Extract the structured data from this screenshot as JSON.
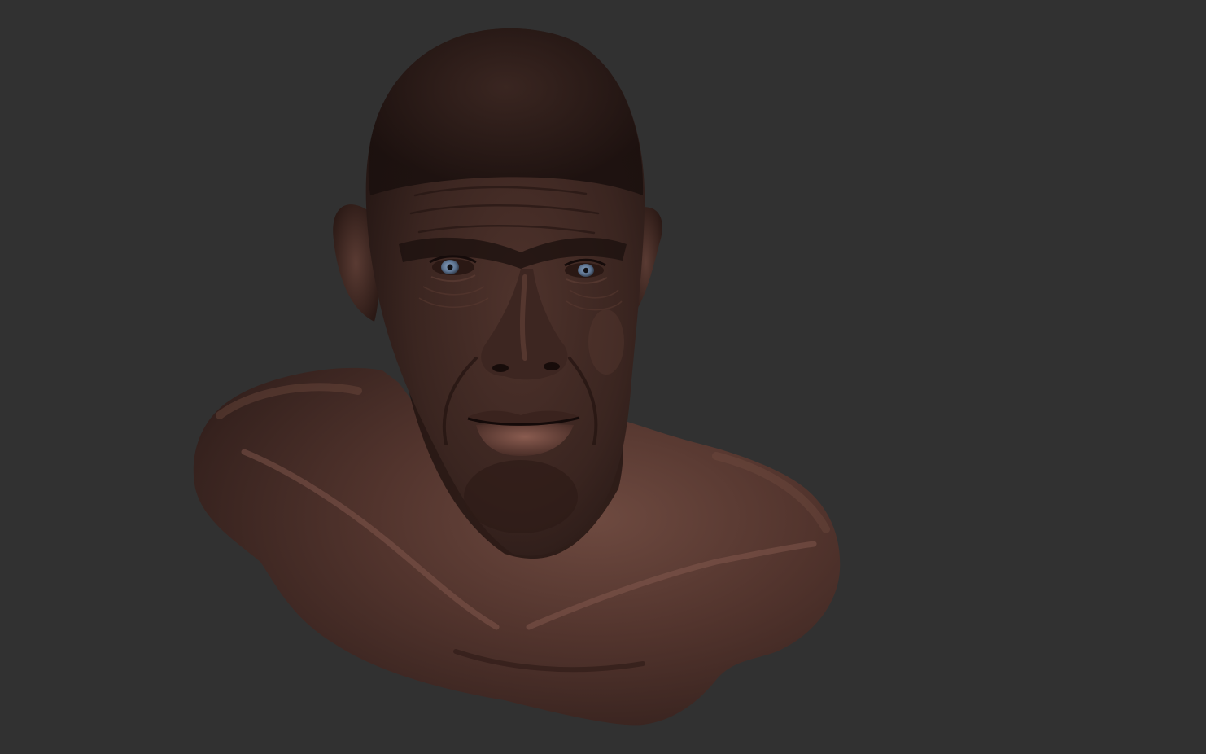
{
  "scene": {
    "subject": "sculpted-bust",
    "colors": {
      "background": "#313131",
      "skin_base": "#4a2e28",
      "skin_light": "#7a5348",
      "skin_shadow": "#1f1210",
      "iris": "#5d7390",
      "lip": "#7d5247"
    }
  }
}
